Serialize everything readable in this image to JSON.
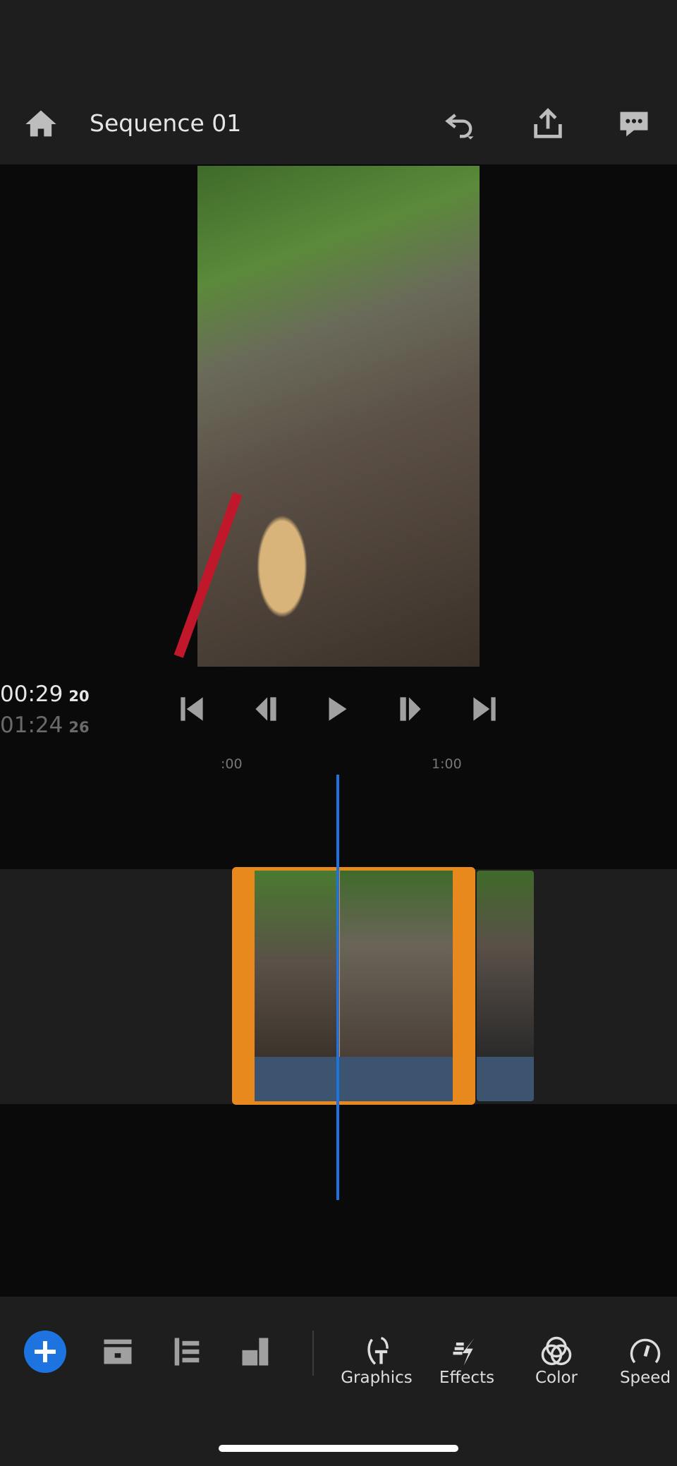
{
  "header": {
    "title": "Sequence 01",
    "icons": [
      "home-icon",
      "undo-icon",
      "share-icon",
      "comments-icon"
    ]
  },
  "player": {
    "current_time": "00:29",
    "current_frames": "20",
    "duration": "01:24",
    "duration_frames": "26"
  },
  "ruler": {
    "labels": [
      ":00",
      "1:00"
    ]
  },
  "toolbar": {
    "tools": [
      {
        "label": "Graphics"
      },
      {
        "label": "Effects"
      },
      {
        "label": "Color"
      },
      {
        "label": "Speed"
      }
    ]
  },
  "colors": {
    "accent": "#1d73e0",
    "clip_selected": "#e8891d",
    "audio": "#3d5470"
  }
}
